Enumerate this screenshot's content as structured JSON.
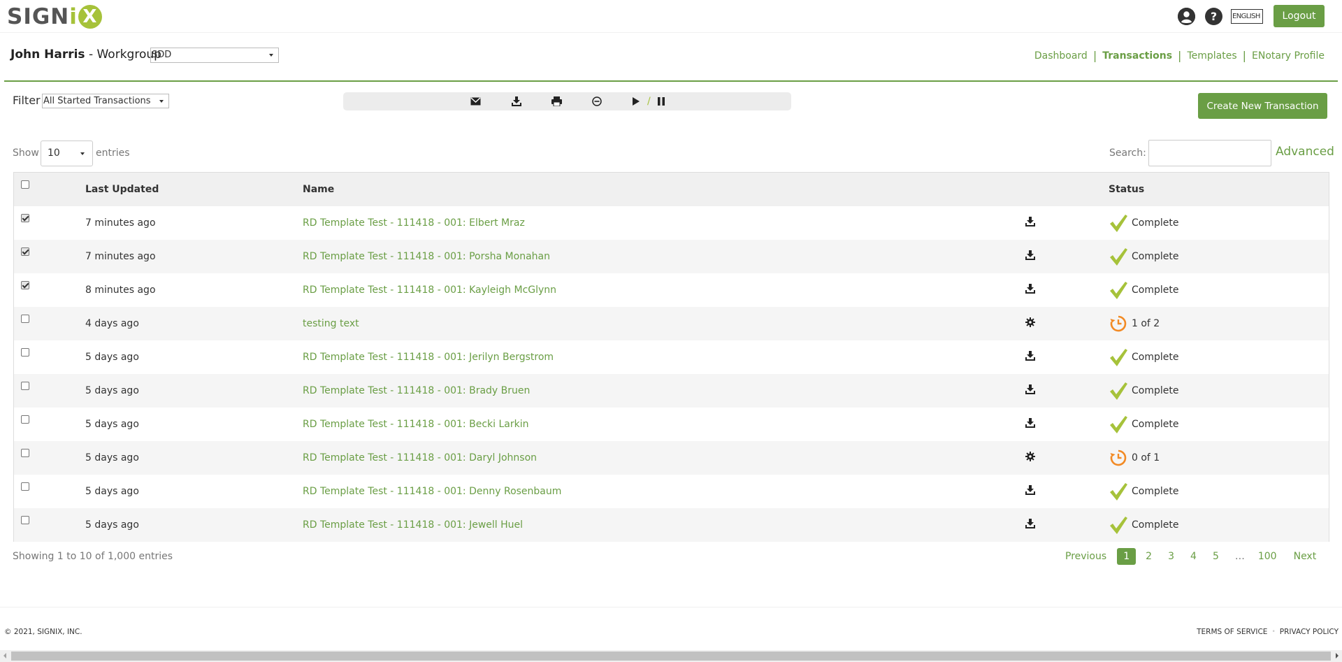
{
  "brand": {
    "logo_text": "SIGNiX",
    "accent_color": "#a6c23a",
    "primary_color": "#6a9e45",
    "status_pending_color": "#f28a24"
  },
  "topbar": {
    "language": "ENGLISH",
    "logout_label": "Logout",
    "profile_icon": "user-circle-icon",
    "help_icon": "question-circle-icon"
  },
  "header": {
    "user_name": "John Harris",
    "workgroup_label": " - Workgroup",
    "workgroup_value": "SDD",
    "nav": {
      "dashboard": "Dashboard",
      "transactions": "Transactions",
      "templates": "Templates",
      "separator": "|",
      "enotary": "ENotary Profile"
    }
  },
  "filter": {
    "label": "Filter",
    "value": "All Started Transactions"
  },
  "toolbar": {
    "icons": [
      "envelope-icon",
      "download-icon",
      "print-icon",
      "cancel-icon",
      "play-icon",
      "pause-icon"
    ],
    "slash": "/"
  },
  "create_button": "Create New Transaction",
  "table_controls": {
    "show_label": "Show",
    "page_size": "10",
    "entries_label": "entries",
    "search_label": "Search:",
    "advanced_label": "Advanced"
  },
  "table": {
    "headers": {
      "last_updated": "Last Updated",
      "name": "Name",
      "status": "Status"
    },
    "rows": [
      {
        "checked": true,
        "updated": "7 minutes ago",
        "name": "RD Template Test - 111418 - 001: Elbert Mraz",
        "action": "download",
        "status": "complete",
        "status_text": "Complete"
      },
      {
        "checked": true,
        "updated": "7 minutes ago",
        "name": "RD Template Test - 111418 - 001: Porsha Monahan",
        "action": "download",
        "status": "complete",
        "status_text": "Complete"
      },
      {
        "checked": true,
        "updated": "8 minutes ago",
        "name": "RD Template Test - 111418 - 001: Kayleigh McGlynn",
        "action": "download",
        "status": "complete",
        "status_text": "Complete"
      },
      {
        "checked": false,
        "updated": "4 days ago",
        "name": "testing text",
        "action": "settings",
        "status": "pending",
        "status_text": "1 of 2"
      },
      {
        "checked": false,
        "updated": "5 days ago",
        "name": "RD Template Test - 111418 - 001: Jerilyn Bergstrom",
        "action": "download",
        "status": "complete",
        "status_text": "Complete"
      },
      {
        "checked": false,
        "updated": "5 days ago",
        "name": "RD Template Test - 111418 - 001: Brady Bruen",
        "action": "download",
        "status": "complete",
        "status_text": "Complete"
      },
      {
        "checked": false,
        "updated": "5 days ago",
        "name": "RD Template Test - 111418 - 001: Becki Larkin",
        "action": "download",
        "status": "complete",
        "status_text": "Complete"
      },
      {
        "checked": false,
        "updated": "5 days ago",
        "name": "RD Template Test - 111418 - 001: Daryl Johnson",
        "action": "settings",
        "status": "pending",
        "status_text": "0 of 1"
      },
      {
        "checked": false,
        "updated": "5 days ago",
        "name": "RD Template Test - 111418 - 001: Denny Rosenbaum",
        "action": "download",
        "status": "complete",
        "status_text": "Complete"
      },
      {
        "checked": false,
        "updated": "5 days ago",
        "name": "RD Template Test - 111418 - 001: Jewell Huel",
        "action": "download",
        "status": "complete",
        "status_text": "Complete"
      }
    ]
  },
  "info": "Showing 1 to 10 of 1,000 entries",
  "pagination": {
    "previous": "Previous",
    "pages": [
      "1",
      "2",
      "3",
      "4",
      "5"
    ],
    "current": "1",
    "ellipsis": "…",
    "last": "100",
    "next": "Next"
  },
  "footer": {
    "copyright": "© 2021, SIGNIX, INC.",
    "terms": "TERMS OF SERVICE",
    "privacy": "PRIVACY POLICY"
  }
}
